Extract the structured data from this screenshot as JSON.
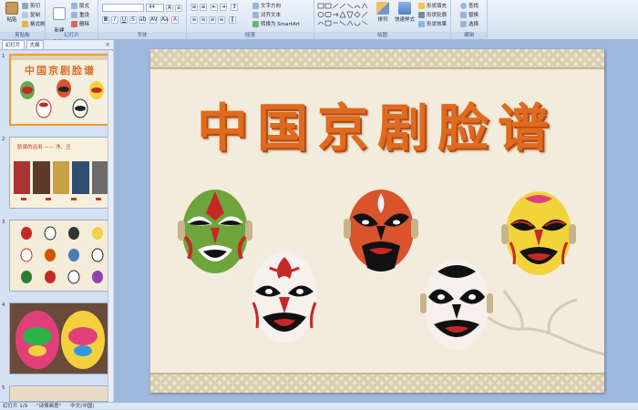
{
  "ribbon": {
    "clipboard": {
      "group": "剪贴板",
      "paste": "粘贴",
      "cut": "剪切",
      "copy": "复制",
      "format_painter": "格式刷"
    },
    "slides": {
      "group": "幻灯片",
      "new_slide": "新建\n幻灯片",
      "layout": "版式",
      "reset": "重设",
      "delete": "删除"
    },
    "font": {
      "group": "字体",
      "size": "44"
    },
    "paragraph": {
      "group": "段落",
      "text_direction": "文字方向",
      "align_text": "对齐文本",
      "smartart": "转换为 SmartArt"
    },
    "drawing": {
      "group": "绘图",
      "arrange": "排列",
      "quick_styles": "快速样式",
      "shape_fill": "形状填充",
      "shape_outline": "形状轮廓",
      "shape_effects": "形状效果"
    },
    "editing": {
      "group": "编辑",
      "find": "查找",
      "replace": "替换",
      "select": "选择"
    }
  },
  "panel": {
    "tab_slides": "幻灯片",
    "tab_outline": "大纲",
    "close": "×"
  },
  "thumbnails": [
    {
      "num": "1",
      "title": "中国京剧脸谱",
      "selected": true
    },
    {
      "num": "2",
      "title": "脸谱的运用 —— 净、丑",
      "selected": false
    },
    {
      "num": "3",
      "title": "",
      "selected": false
    },
    {
      "num": "4",
      "title": "",
      "selected": false
    },
    {
      "num": "5",
      "title": "",
      "selected": false
    }
  ],
  "slide": {
    "title": "中国京剧脸谱"
  },
  "status": {
    "slide_info": "幻灯片 1/9",
    "theme": "\"诗情画意\"",
    "language": "中文(中国)"
  },
  "colors": {
    "title": "#e06a1e",
    "selection": "#f29b2e",
    "ribbon": "#dbe6f4"
  }
}
